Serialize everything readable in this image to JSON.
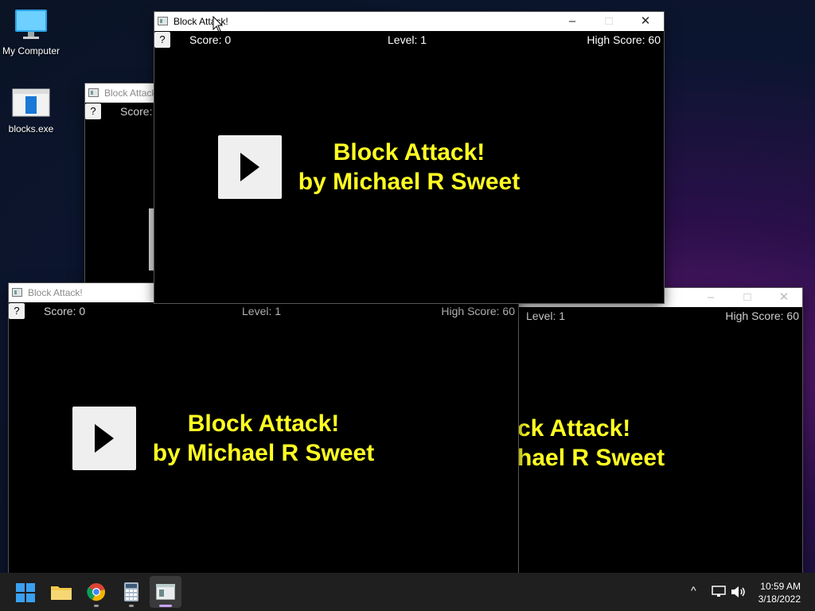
{
  "desktop": {
    "icons": [
      {
        "label": "My Computer"
      },
      {
        "label": "blocks.exe"
      }
    ]
  },
  "windows": {
    "back": {
      "title": "Block Attack!",
      "score": "Score:",
      "help": "?"
    },
    "front": {
      "title": "Block Attack!",
      "help": "?",
      "score": "Score: 0",
      "level": "Level: 1",
      "high_score": "High Score: 60",
      "banner_line1": "Block Attack!",
      "banner_line2": "by Michael R Sweet"
    },
    "bottom_left": {
      "title": "Block Attack!",
      "help": "?",
      "score": "Score: 0",
      "level": "Level: 1",
      "high_score": "High Score: 60",
      "banner_line1": "Block Attack!",
      "banner_line2": "by Michael R Sweet"
    },
    "bottom_right": {
      "level": "Level: 1",
      "high_score": "High Score: 60",
      "banner_line1": "ck Attack!",
      "banner_line2": "hael R Sweet"
    }
  },
  "taskbar": {
    "apps": [
      "start-icon",
      "file-explorer-icon",
      "chrome-icon",
      "calculator-icon",
      "block-attack-app-icon"
    ],
    "tray": {
      "chevron": "^",
      "time": "10:59 AM",
      "date": "3/18/2022"
    }
  },
  "colors": {
    "banner_yellow": "#ffff22",
    "active_indicator": "#c8a2ff"
  }
}
